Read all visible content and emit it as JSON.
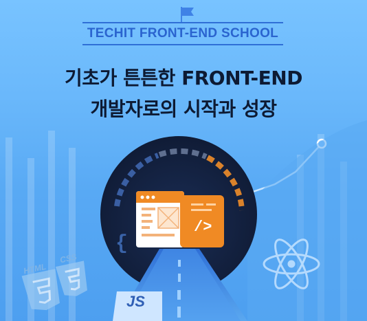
{
  "header": {
    "brand": "TECHIT FRONT-END SCHOOL",
    "title_line1": "기초가 튼튼한 FRONT-END",
    "title_line2": "개발자로의 시작과 성장"
  },
  "badges": {
    "js": "JS",
    "html": "HTML",
    "css": "CSS",
    "code": "/>"
  },
  "icons": [
    "flag-icon",
    "browser-window-icon",
    "code-editor-icon",
    "atom-icon",
    "curly-brace-icon",
    "html5-shield-icon",
    "css3-shield-icon"
  ],
  "colors": {
    "background": "#6ab8fb",
    "brand_text": "#2a64cf",
    "title_text": "#0d1a33",
    "accent_orange": "#f08a24",
    "portal_dark": "#13213f"
  }
}
